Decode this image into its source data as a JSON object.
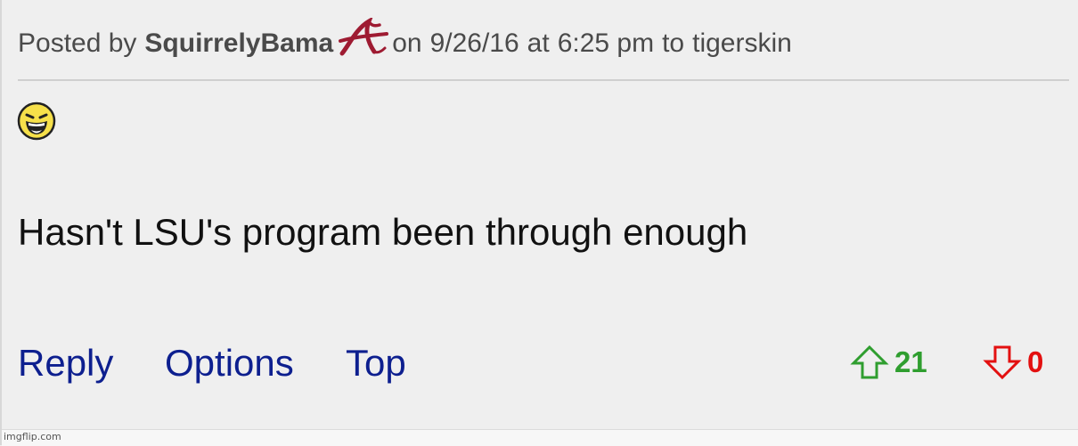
{
  "post": {
    "posted_by_prefix": "Posted by",
    "poster_name": "SquirrelyBama",
    "team_logo_icon": "alabama-script-a-icon",
    "date_prefix": "on",
    "date": "9/26/16",
    "time_prefix": "at",
    "time": "6:25 pm",
    "to_prefix": "to",
    "reply_to_user": "tigerskin",
    "emoji_icon": "laughing-emoji-icon",
    "body": "Hasn't LSU's program been through enough"
  },
  "actions": {
    "reply": "Reply",
    "options": "Options",
    "top": "Top"
  },
  "votes": {
    "up_count": "21",
    "down_count": "0",
    "up_color": "#2f9e2f",
    "down_color": "#e31010"
  },
  "colors": {
    "link": "#0d1f8f",
    "logo_crimson": "#9e1b32",
    "background": "#efefef"
  },
  "watermark": "imgflip.com"
}
